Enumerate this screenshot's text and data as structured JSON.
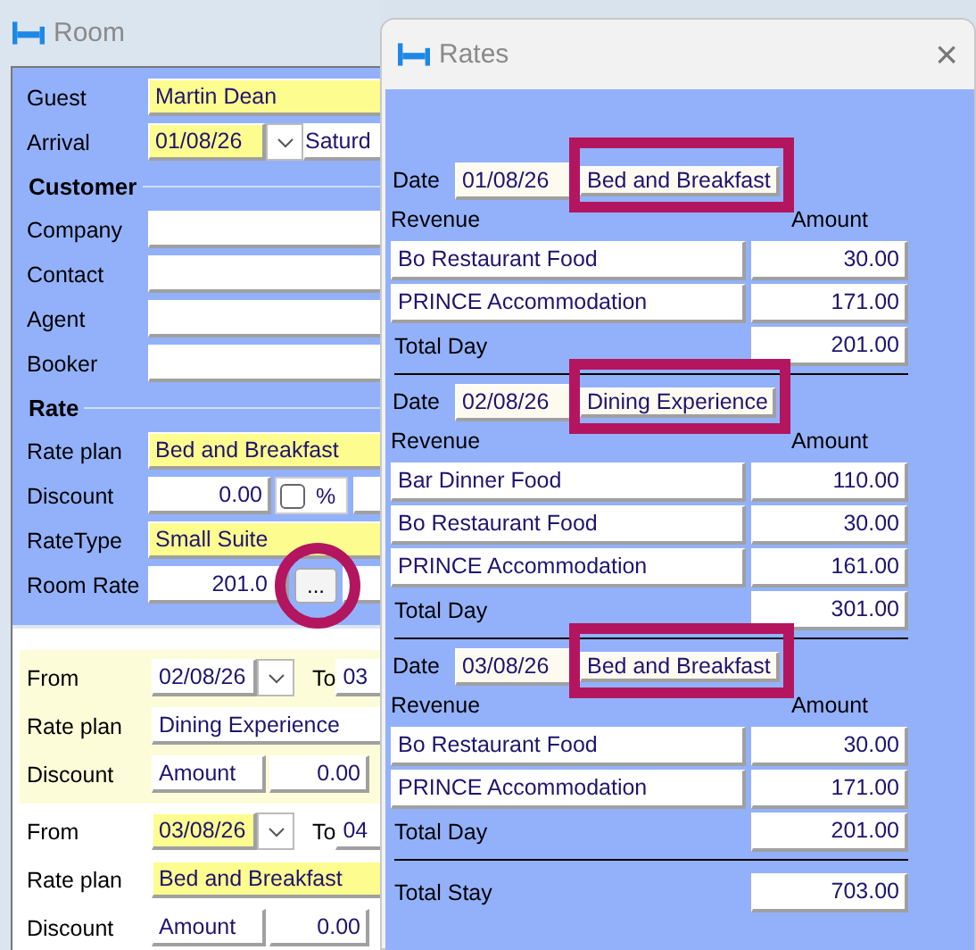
{
  "room": {
    "title": "Room",
    "guest": {
      "label": "Guest",
      "value": "Martin Dean",
      "highlighted": true
    },
    "arrival": {
      "label": "Arrival",
      "date": "01/08/26",
      "day": "Saturd",
      "highlighted": true
    },
    "customer": {
      "heading": "Customer",
      "fields": [
        {
          "label": "Company"
        },
        {
          "label": "Contact"
        },
        {
          "label": "Agent"
        },
        {
          "label": "Booker"
        }
      ]
    },
    "rate": {
      "heading": "Rate",
      "rate_plan": {
        "label": "Rate plan",
        "value": "Bed and Breakfast",
        "highlighted": true
      },
      "discount": {
        "label": "Discount",
        "value": "0.00",
        "checked": false,
        "unit": "%"
      },
      "rate_type": {
        "label": "RateType",
        "value": "Small Suite",
        "highlighted": true
      },
      "room_rate": {
        "label": "Room Rate",
        "value": "201.0",
        "button": "...",
        "annotated": true
      }
    },
    "periods": [
      {
        "selected": true,
        "highlighted": false,
        "from_label": "From",
        "from": "02/08/26",
        "to_label": "To",
        "to": "03",
        "rate_plan_label": "Rate plan",
        "rate_plan": "Dining Experience",
        "discount_label": "Discount",
        "discount_type": "Amount",
        "discount_value": "0.00"
      },
      {
        "selected": false,
        "highlighted": true,
        "from_label": "From",
        "from": "03/08/26",
        "to_label": "To",
        "to": "04",
        "rate_plan_label": "Rate plan",
        "rate_plan": "Bed and Breakfast",
        "discount_label": "Discount",
        "discount_type": "Amount",
        "discount_value": "0.00"
      }
    ]
  },
  "rates": {
    "title": "Rates",
    "close": "×",
    "days": [
      {
        "date_label": "Date",
        "date": "01/08/26",
        "plan": "Bed and Breakfast",
        "annotated": true,
        "revenue_header": "Revenue",
        "amount_header": "Amount",
        "lines": [
          {
            "name": "Bo Restaurant Food",
            "amount": "30.00"
          },
          {
            "name": "PRINCE Accommodation",
            "amount": "171.00"
          }
        ],
        "total_label": "Total Day",
        "total": "201.00"
      },
      {
        "date_label": "Date",
        "date": "02/08/26",
        "plan": "Dining Experience",
        "annotated": true,
        "revenue_header": "Revenue",
        "amount_header": "Amount",
        "lines": [
          {
            "name": "Bar Dinner Food",
            "amount": "110.00"
          },
          {
            "name": "Bo Restaurant Food",
            "amount": "30.00"
          },
          {
            "name": "PRINCE Accommodation",
            "amount": "161.00"
          }
        ],
        "total_label": "Total Day",
        "total": "301.00"
      },
      {
        "date_label": "Date",
        "date": "03/08/26",
        "plan": "Bed and Breakfast",
        "annotated": true,
        "revenue_header": "Revenue",
        "amount_header": "Amount",
        "lines": [
          {
            "name": "Bo Restaurant Food",
            "amount": "30.00"
          },
          {
            "name": "PRINCE Accommodation",
            "amount": "171.00"
          }
        ],
        "total_label": "Total Day",
        "total": "201.00"
      }
    ],
    "total_stay": {
      "label": "Total Stay",
      "value": "703.00"
    }
  }
}
